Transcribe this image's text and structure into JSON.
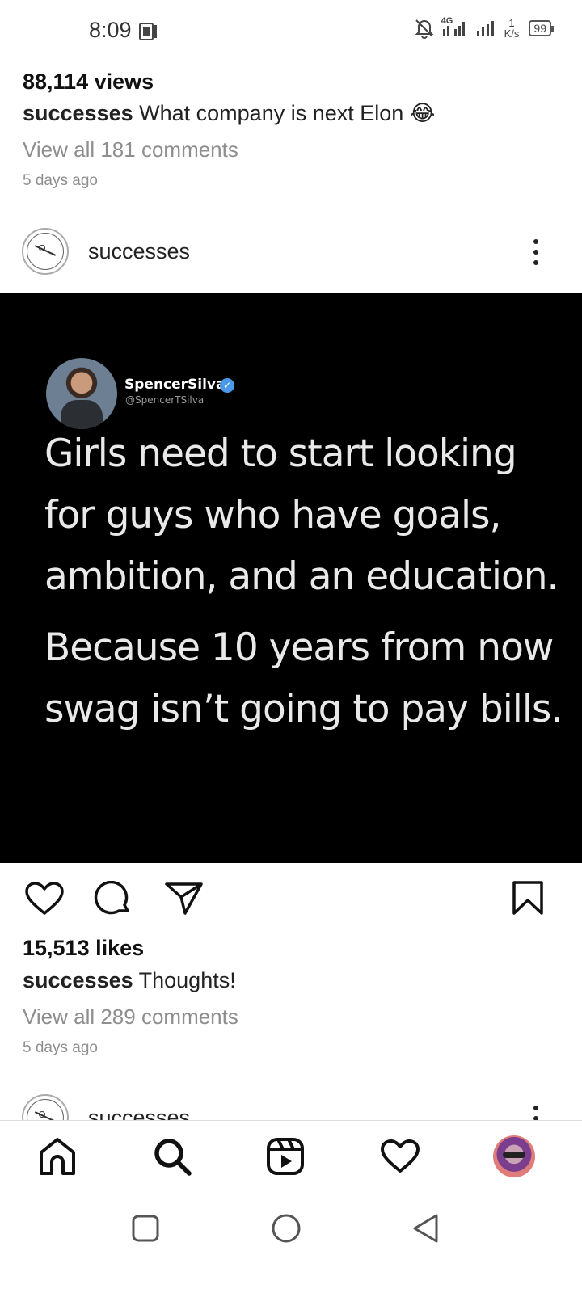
{
  "status_bar": {
    "time": "8:09",
    "network_type": "4G",
    "net_speed_value": "1",
    "net_speed_unit": "K/s",
    "battery": "99"
  },
  "previous_post": {
    "views": "88,114 views",
    "caption_user": "successes",
    "caption_text": "What company is next Elon",
    "caption_emoji": "😂",
    "view_all_comments": "View all 181 comments",
    "time_ago": "5 days ago"
  },
  "post": {
    "username": "successes",
    "tweet": {
      "name": "SpencerSilva",
      "handle": "@SpencerTSilva",
      "lines": [
        "Girls need to start looking",
        "for guys who have goals,",
        "ambition, and an education.",
        "Because 10 years from now",
        "swag isn’t going to pay bills."
      ]
    },
    "likes": "15,513 likes",
    "caption_user": "successes",
    "caption_text": "Thoughts!",
    "view_all_comments": "View all 289 comments",
    "time_ago": "5 days ago"
  },
  "next_post": {
    "username": "successes"
  },
  "icons": {
    "status": [
      "photo-notification-icon",
      "mute-bell-icon",
      "signal-icon",
      "battery-icon"
    ],
    "actions": [
      "heart-icon",
      "comment-icon",
      "share-icon",
      "bookmark-icon"
    ],
    "bottom_nav": [
      "home-icon",
      "search-icon",
      "reels-icon",
      "activity-heart-icon",
      "profile-avatar"
    ],
    "system_nav": [
      "recents-square-icon",
      "home-circle-icon",
      "back-triangle-icon"
    ]
  }
}
